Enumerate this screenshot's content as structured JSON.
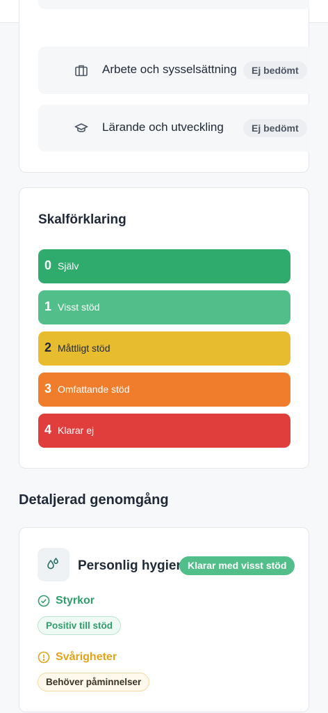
{
  "header": {
    "logo_icon": "home-icon"
  },
  "areas": {
    "items": [
      {
        "icon": "briefcase-icon",
        "label": "Arbete och sysselsättning",
        "status": "Ej bedömt"
      },
      {
        "icon": "graduation-cap-icon",
        "label": "Lärande och utveckling",
        "status": "Ej bedömt"
      }
    ]
  },
  "scale": {
    "title": "Skalförklaring",
    "levels": [
      {
        "number": "0",
        "label": "Själv",
        "color": "#2fab6d"
      },
      {
        "number": "1",
        "label": "Visst stöd",
        "color": "#52bf8a"
      },
      {
        "number": "2",
        "label": "Måttligt stöd",
        "color": "#e8bc2f"
      },
      {
        "number": "3",
        "label": "Omfattande stöd",
        "color": "#ef7d2b"
      },
      {
        "number": "4",
        "label": "Klarar ej",
        "color": "#e03d3d"
      }
    ]
  },
  "detail": {
    "section_title": "Detaljerad genomgång",
    "item": {
      "icon": "water-drops-icon",
      "title": "Personlig hygien",
      "status": "Klarar med visst stöd",
      "strengths_title": "Styrkor",
      "strengths": [
        "Positiv till stöd"
      ],
      "difficulties_title": "Svårigheter",
      "difficulties": [
        "Behöver påminnelser"
      ]
    }
  }
}
